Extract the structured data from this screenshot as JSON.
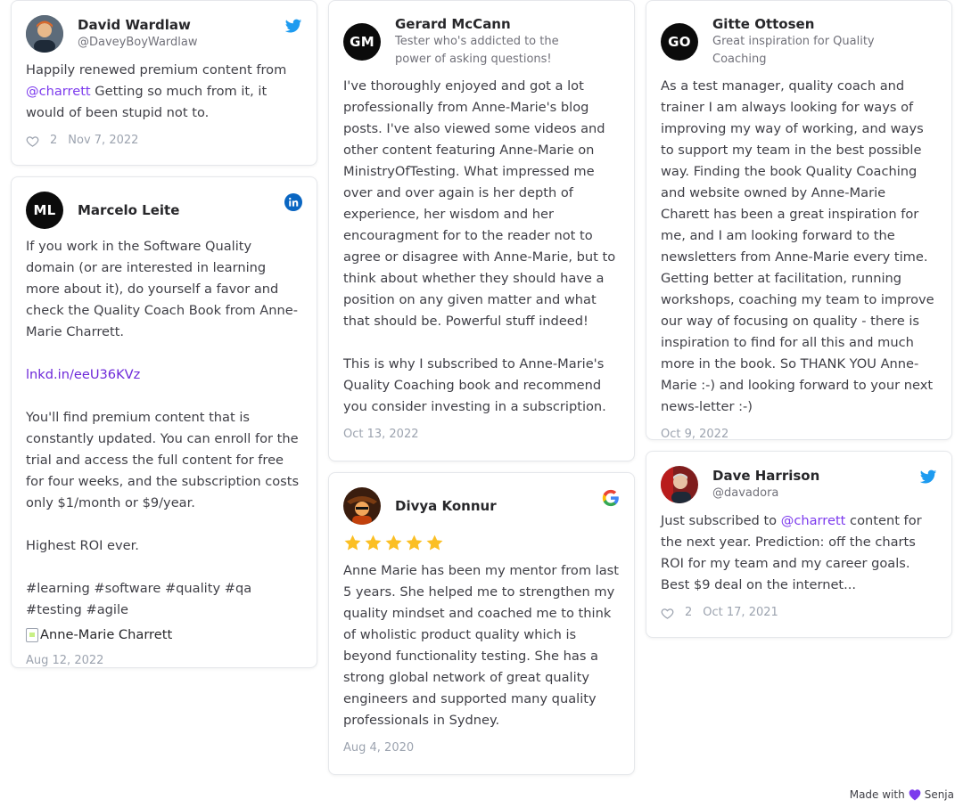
{
  "cards": {
    "david": {
      "name": "David Wardlaw",
      "handle": "@DaveyBoyWardlaw",
      "platform": "twitter-icon",
      "text_before": "Happily renewed premium content from ",
      "mention": "@charrett",
      "text_after": " Getting so much from it, it would of been stupid not to.",
      "likes": "2",
      "date": "Nov 7, 2022"
    },
    "marcelo": {
      "name": "Marcelo Leite",
      "initials": "ML",
      "platform": "linkedin-icon",
      "text_para1": "If you work in the Software Quality domain (or are interested in learning more about it), do yourself a favor and check the Quality Coach Book from Anne-Marie Charrett.",
      "link": "lnkd.in/eeU36KVz",
      "text_para2": "You'll find premium content that is constantly updated. You can enroll for the trial and access the full content for free for four weeks, and the subscription costs only $1/month or $9/year.\n\nHighest ROI ever.\n\n#learning #software #quality #qa #testing #agile",
      "image_alt": "Anne-Marie Charrett",
      "date": "Aug 12, 2022"
    },
    "gerard": {
      "name": "Gerard McCann",
      "initials": "GM",
      "subtitle": "Tester who's addicted to the power of asking questions!",
      "text": "I've thoroughly enjoyed and got a lot professionally from Anne-Marie's blog posts. I've also viewed some videos and other content featuring Anne-Marie on MinistryOfTesting. What impressed me over and over again is her depth of experience, her wisdom and her encouragment for to the reader not to agree or disagree with Anne-Marie, but to think about whether they should have a position on any given matter and what that should be. Powerful stuff indeed!\n\nThis is why I subscribed to Anne-Marie's Quality Coaching book and recommend you consider investing in a subscription.",
      "date": "Oct 13, 2022"
    },
    "divya": {
      "name": "Divya Konnur",
      "platform": "google-icon",
      "rating": 5,
      "text": "Anne Marie has been my mentor from last 5 years. She helped me to strengthen my quality mindset and coached me to think of wholistic product quality which is beyond functionality testing. She has a strong global network of great quality engineers and supported many quality professionals in Sydney.",
      "date": "Aug 4, 2020"
    },
    "gitte": {
      "name": "Gitte Ottosen",
      "initials": "GO",
      "subtitle": "Great inspiration for Quality Coaching",
      "text": "As a test manager, quality coach and trainer I am always looking for ways of improving my way of working, and ways to support my team in the best possible way. Finding the book Quality Coaching and website owned by Anne-Marie Charett has been a great inspiration for me, and I am looking forward to the newsletters from Anne-Marie every time. Getting better at facilitation, running workshops, coaching my team to improve our way of focusing on quality - there is inspiration to find for all this and much more in the book. So THANK YOU Anne-Marie :-) and looking forward to your next news-letter :-)",
      "date": "Oct 9, 2022"
    },
    "dave": {
      "name": "Dave Harrison",
      "handle": "@davadora",
      "platform": "twitter-icon",
      "text_before": "Just subscribed to ",
      "mention": "@charrett",
      "text_after": " content for the next year. Prediction: off the charts ROI for my team and my career goals. Best $9 deal on the internet...",
      "likes": "2",
      "date": "Oct 17, 2021"
    }
  },
  "footer": {
    "made_with": "Made with",
    "brand": "Senja"
  },
  "colors": {
    "accent": "#7c3aed",
    "twitter": "#1d9bf0",
    "linkedin": "#0a66c2",
    "star": "#fbbf24"
  }
}
